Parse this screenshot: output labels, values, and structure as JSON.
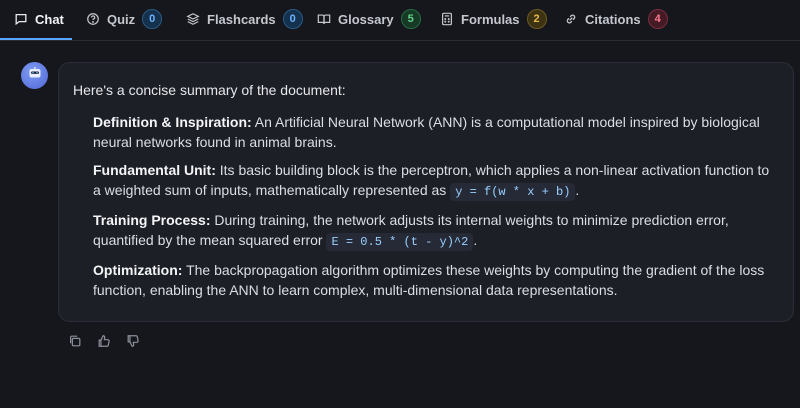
{
  "tabs": [
    {
      "label": "Chat",
      "icon": "chat-icon",
      "badge": null
    },
    {
      "label": "Quiz",
      "icon": "help-circle-icon",
      "badge": "0"
    },
    {
      "label": "Flashcards",
      "icon": "layers-icon",
      "badge": "0"
    },
    {
      "label": "Glossary",
      "icon": "book-open-icon",
      "badge": "5"
    },
    {
      "label": "Formulas",
      "icon": "calculator-icon",
      "badge": "2"
    },
    {
      "label": "Citations",
      "icon": "link-icon",
      "badge": "4"
    }
  ],
  "badge_colors": {
    "quiz": "#6fb3ff",
    "flashcards": "#6fb3ff",
    "glossary": "#63d18c",
    "formulas": "#e6b94a",
    "citations": "#ff7b8f"
  },
  "accent": "#58a6ff",
  "message": {
    "intro": "Here's a concise summary of the document:",
    "items": [
      {
        "title": "Definition & Inspiration:",
        "text": "An Artificial Neural Network (ANN) is a computational model inspired by biological neural networks found in animal brains."
      },
      {
        "title": "Fundamental Unit:",
        "text": "Its basic building block is the perceptron, which applies a non-linear activation function to a weighted sum of inputs, mathematically represented as",
        "code": "y = f(w * x + b)",
        "after": "."
      },
      {
        "title": "Training Process:",
        "text": "During training, the network adjusts its internal weights to minimize prediction error, quantified by the mean squared error",
        "code": "E = 0.5 * (t - y)^2",
        "after": "."
      },
      {
        "title": "Optimization:",
        "text": "The backpropagation algorithm optimizes these weights by computing the gradient of the loss function, enabling the ANN to learn complex, multi-dimensional data representations."
      }
    ]
  },
  "actions": [
    {
      "icon": "copy-icon"
    },
    {
      "icon": "thumbs-up-icon"
    },
    {
      "icon": "thumbs-down-icon"
    }
  ]
}
